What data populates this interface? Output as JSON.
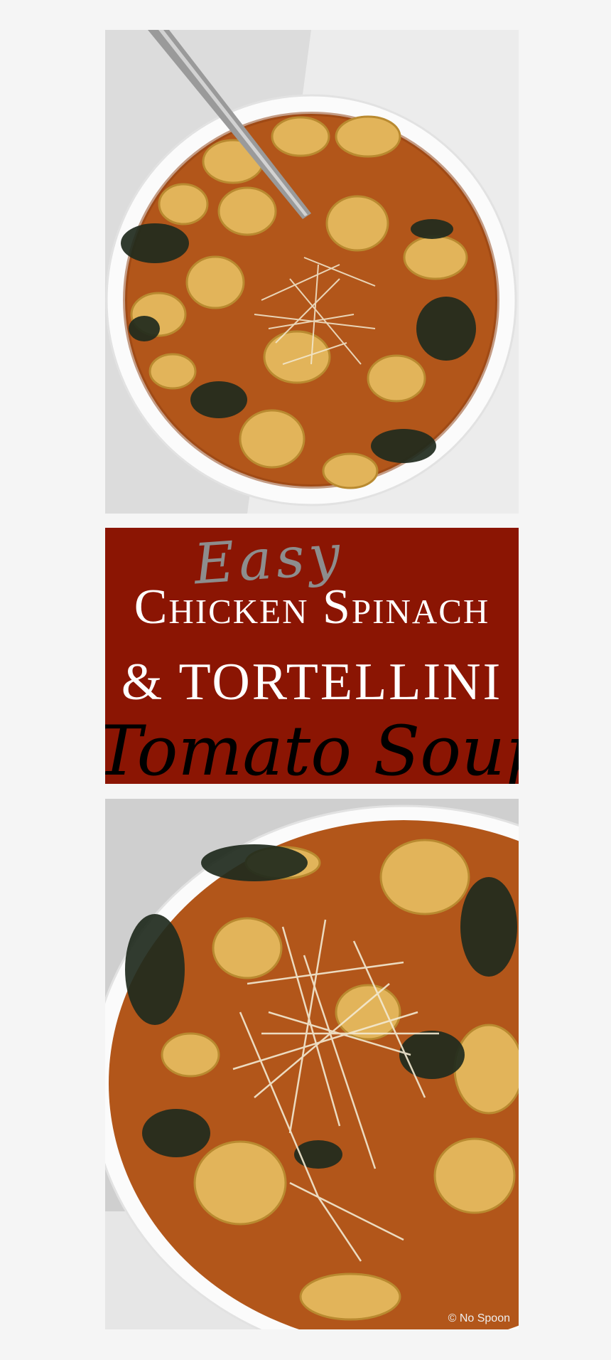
{
  "banner": {
    "word_easy": "Easy",
    "line1": "Chicken Spinach",
    "line2": "& TORTELLINI",
    "line3": "Tomato Soup"
  },
  "watermark": "© No Spoon",
  "colors": {
    "page_background": "#f5f5f5",
    "banner_red": "#8b1503",
    "soup_broth": "#b2561a",
    "tortellini": "#e2b45a",
    "spinach": "#1f2a1d",
    "bowl": "#fbfbfb"
  }
}
